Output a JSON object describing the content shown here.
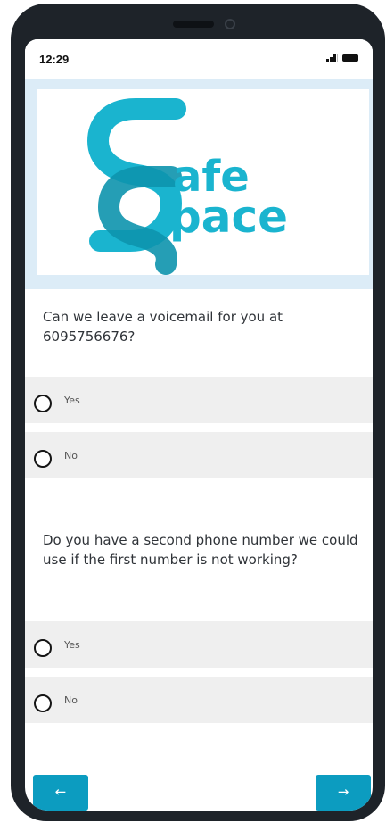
{
  "status_bar": {
    "time": "12:29",
    "signal_icon": "signal-bars-icon",
    "battery_icon": "battery-icon"
  },
  "logo": {
    "text_line1": "afe",
    "text_line2": "pace",
    "monogram": "SS",
    "colors": {
      "light": "#1ab4cf",
      "dark": "#0d93ad"
    }
  },
  "questions": [
    {
      "text": "Can we leave a voicemail for you at 6095756676?",
      "options": [
        {
          "label": "Yes",
          "selected": false
        },
        {
          "label": "No",
          "selected": false
        }
      ]
    },
    {
      "text": "Do you have a second phone number we could use if the first number is not working?",
      "options": [
        {
          "label": "Yes",
          "selected": false
        },
        {
          "label": "No",
          "selected": false
        }
      ]
    }
  ],
  "navigation": {
    "back_label": "←",
    "next_label": "→",
    "back_icon": "arrow-left-icon",
    "next_icon": "arrow-right-icon"
  },
  "colors": {
    "accent": "#0c9cc0",
    "header_band": "#dcecf7",
    "option_background": "#efefef",
    "device_frame": "#1e2329"
  }
}
